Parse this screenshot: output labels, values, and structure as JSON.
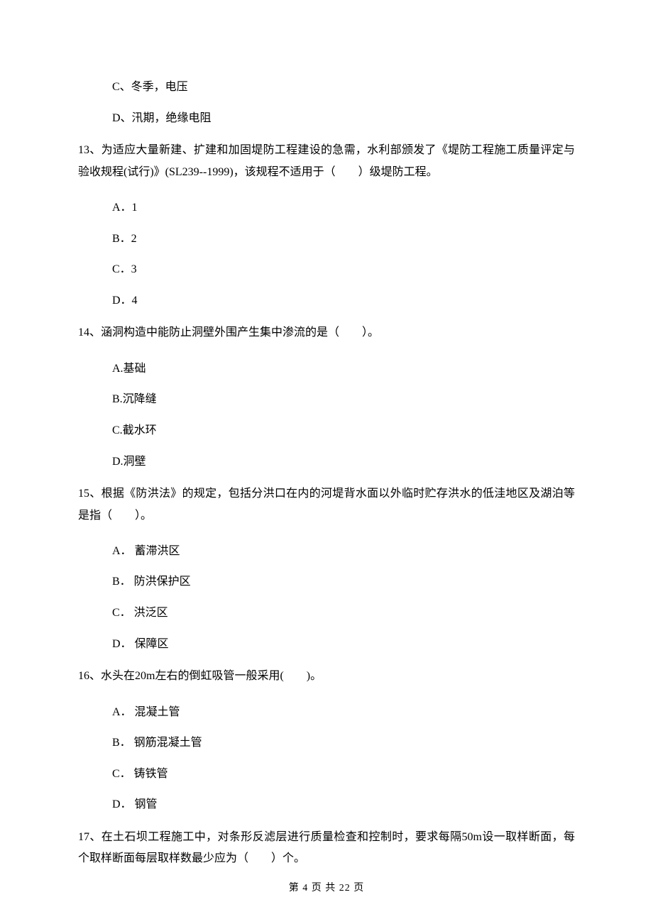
{
  "options_top": [
    "C、冬季，电压",
    "D、汛期，绝缘电阻"
  ],
  "q13": {
    "text": "13、为适应大量新建、扩建和加固堤防工程建设的急需，水利部颁发了《堤防工程施工质量评定与验收规程(试行)》(SL239--1999)，该规程不适用于（　　）级堤防工程。",
    "options": [
      "A．1",
      "B．2",
      "C．3",
      "D．4"
    ]
  },
  "q14": {
    "text": "14、涵洞构造中能防止洞壁外围产生集中渗流的是（　　）。",
    "options": [
      "A.基础",
      "B.沉降缝",
      "C.截水环",
      "D.洞壁"
    ]
  },
  "q15": {
    "text": "15、根据《防洪法》的规定，包括分洪口在内的河堤背水面以外临时贮存洪水的低洼地区及湖泊等是指（　　）。",
    "options": [
      "A． 蓄滞洪区",
      "B． 防洪保护区",
      "C． 洪泛区",
      "D． 保障区"
    ]
  },
  "q16": {
    "text": "16、水头在20m左右的倒虹吸管一般采用(　　)。",
    "options": [
      "A． 混凝土管",
      "B． 钢筋混凝土管",
      "C． 铸铁管",
      "D． 钢管"
    ]
  },
  "q17": {
    "text": "17、在土石坝工程施工中，对条形反滤层进行质量检查和控制时，要求每隔50m设一取样断面，每个取样断面每层取样数最少应为（　　）个。"
  },
  "footer": "第 4 页 共 22 页"
}
